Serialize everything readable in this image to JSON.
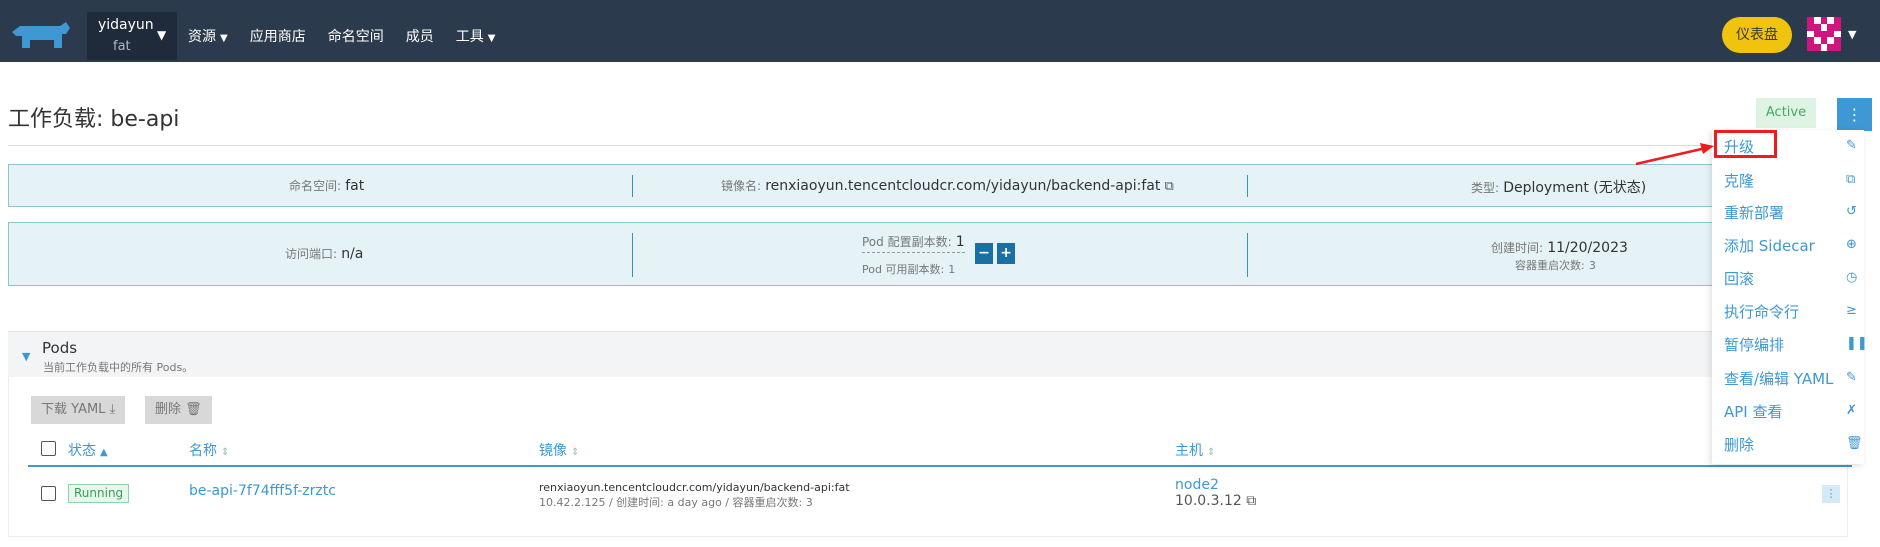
{
  "header": {
    "cluster_name": "yidayun",
    "cluster_namespace": "fat",
    "nav": [
      "资源",
      "应用商店",
      "命名空间",
      "成员",
      "工具"
    ],
    "dashboard_label": "仪表盘",
    "colors": {
      "bg": "#2b3a4d",
      "accent": "#f0c30f"
    }
  },
  "page": {
    "title": "工作负载: be-api",
    "status": "Active"
  },
  "info": {
    "namespace_label": "命名空间:",
    "namespace_value": "fat",
    "image_label": "镜像名:",
    "image_value": "renxiaoyun.tencentcloudcr.com/yidayun/backend-api:fat",
    "type_label": "类型:",
    "type_value": "Deployment (无状态)",
    "endpoint_label": "访问端口:",
    "endpoint_value": "n/a",
    "replicas_config_label": "Pod 配置副本数:",
    "replicas_config_value": "1",
    "replicas_avail_label": "Pod 可用副本数:",
    "replicas_avail_value": "1",
    "created_label": "创建时间:",
    "created_value": "11/20/2023",
    "restarts_label": "容器重启次数:",
    "restarts_value": "3"
  },
  "pods": {
    "title": "Pods",
    "subtitle": "当前工作负载中的所有 Pods。",
    "download_label": "下载 YAML",
    "delete_label": "删除",
    "columns": [
      "状态",
      "名称",
      "镜像",
      "主机"
    ],
    "rows": [
      {
        "status": "Running",
        "name": "be-api-7f74fff5f-zrztc",
        "image": "renxiaoyun.tencentcloudcr.com/yidayun/backend-api:fat",
        "meta": "10.42.2.125 / 创建时间: a day ago / 容器重启次数: 3",
        "node": "node2",
        "ip": "10.0.3.12"
      }
    ]
  },
  "menu": {
    "items": [
      {
        "label": "升级",
        "icon": "pencil-icon"
      },
      {
        "label": "克隆",
        "icon": "copy-icon"
      },
      {
        "label": "重新部署",
        "icon": "redeploy-icon"
      },
      {
        "label": "添加 Sidecar",
        "icon": "plus-circle-icon"
      },
      {
        "label": "回滚",
        "icon": "history-icon"
      },
      {
        "label": "执行命令行",
        "icon": "terminal-icon"
      },
      {
        "label": "暂停编排",
        "icon": "pause-icon"
      },
      {
        "label": "查看/编辑 YAML",
        "icon": "pencil-icon"
      },
      {
        "label": "API 查看",
        "icon": "api-icon"
      },
      {
        "label": "删除",
        "icon": "trash-icon"
      }
    ]
  }
}
